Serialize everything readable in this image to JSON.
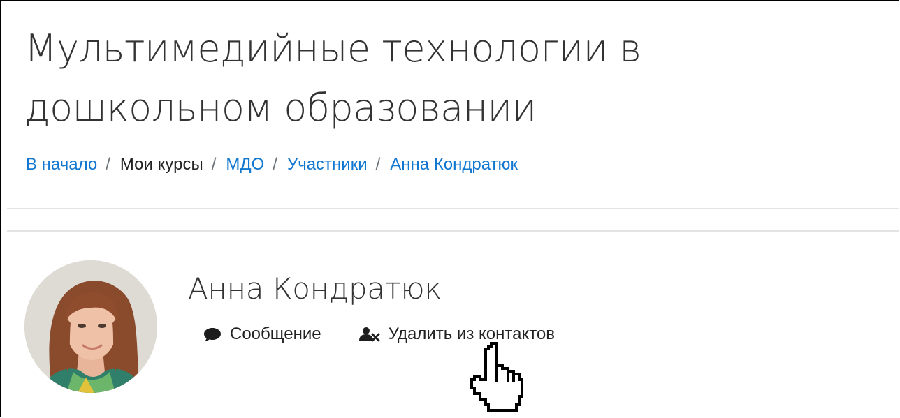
{
  "page": {
    "course_title": "Мультимедийные технологии в дошкольном образовании"
  },
  "breadcrumb": {
    "items": [
      {
        "label": "В начало",
        "link": true
      },
      {
        "label": "Мои курсы",
        "link": false
      },
      {
        "label": "МДО",
        "link": true
      },
      {
        "label": "Участники",
        "link": true
      },
      {
        "label": "Анна Кондратюк",
        "link": true
      }
    ],
    "separator": "/"
  },
  "profile": {
    "name": "Анна Кондратюк",
    "actions": {
      "message_label": "Сообщение",
      "message_icon": "speech-bubble-icon",
      "remove_contact_label": "Удалить из контактов",
      "remove_contact_icon": "user-remove-icon"
    }
  },
  "colors": {
    "link": "#1177d1",
    "text": "#333333",
    "divider": "#e4e4e4"
  }
}
